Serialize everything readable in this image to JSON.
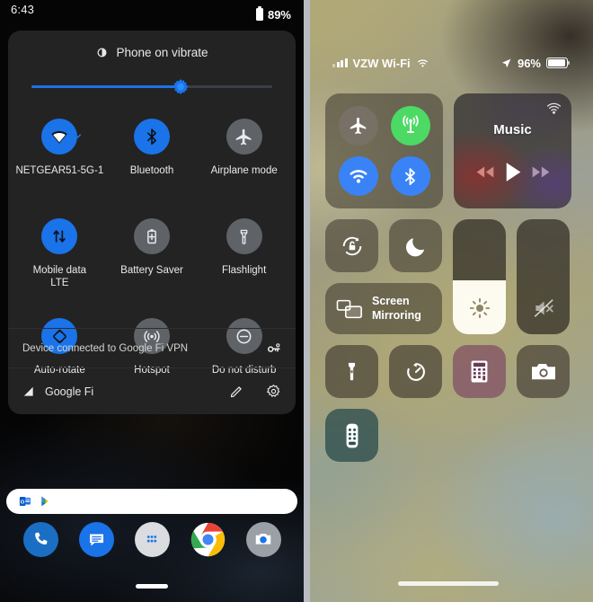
{
  "android": {
    "statusbar": {
      "time": "6:43",
      "battery_percent": "89%",
      "battery_icon": "battery-icon"
    },
    "ringer": {
      "label": "Phone on vibrate",
      "icon": "vibrate-icon"
    },
    "brightness_slider": {
      "name": "brightness-slider",
      "value_percent": 62,
      "accent": "#1a73e8"
    },
    "tiles": [
      {
        "label": "NETGEAR51-5G-1",
        "sub": "",
        "icon": "wifi-icon",
        "state": "on",
        "has_chevron": true
      },
      {
        "label": "Bluetooth",
        "sub": "",
        "icon": "bluetooth-icon",
        "state": "on",
        "has_chevron": false
      },
      {
        "label": "Airplane mode",
        "sub": "",
        "icon": "airplane-icon",
        "state": "off",
        "has_chevron": false
      },
      {
        "label": "Mobile data",
        "sub": "LTE",
        "icon": "mobile-data-icon",
        "state": "on",
        "has_chevron": false
      },
      {
        "label": "Battery Saver",
        "sub": "",
        "icon": "battery-saver-icon",
        "state": "off",
        "has_chevron": false
      },
      {
        "label": "Flashlight",
        "sub": "",
        "icon": "flashlight-icon",
        "state": "off",
        "has_chevron": false
      },
      {
        "label": "Auto-rotate",
        "sub": "",
        "icon": "auto-rotate-icon",
        "state": "on",
        "has_chevron": false
      },
      {
        "label": "Hotspot",
        "sub": "",
        "icon": "hotspot-icon",
        "state": "off",
        "has_chevron": false
      },
      {
        "label": "Do not disturb",
        "sub": "",
        "icon": "do-not-disturb-icon",
        "state": "off",
        "has_chevron": false
      }
    ],
    "vpn_row": {
      "text": "Device connected to Google Fi VPN",
      "icon": "vpn-key-icon"
    },
    "carrier_row": {
      "name": "Google Fi",
      "signal_icon": "signal-bars-icon",
      "edit_icon": "pencil-icon",
      "settings_icon": "gear-icon"
    },
    "notification_card": {
      "icons": [
        "outlook-icon",
        "google-play-icon"
      ]
    },
    "dock": [
      {
        "name": "phone-app",
        "icon": "phone-icon"
      },
      {
        "name": "messages-app",
        "icon": "messages-icon"
      },
      {
        "name": "app-drawer",
        "icon": "dots-grid-icon"
      },
      {
        "name": "chrome-app",
        "icon": "chrome-icon"
      },
      {
        "name": "camera-app",
        "icon": "camera-icon"
      }
    ],
    "home_indicator": "home-pill",
    "colors": {
      "panel_bg": "#232323",
      "accent": "#1a73e8",
      "tile_off": "#5f6368"
    }
  },
  "ios": {
    "statusbar": {
      "carrier": "VZW Wi-Fi",
      "signal_icon": "signal-bars-icon",
      "wifi_icon": "wifi-icon",
      "location_icon": "location-arrow-icon",
      "battery_percent": "96%",
      "battery_icon": "battery-icon",
      "battery_level": 96
    },
    "connectivity": [
      {
        "name": "airplane-mode-toggle",
        "icon": "airplane-icon",
        "state": "off",
        "color": "#7a7268"
      },
      {
        "name": "cellular-data-toggle",
        "icon": "cellular-icon",
        "state": "on",
        "color": "#4cd964"
      },
      {
        "name": "wifi-toggle",
        "icon": "wifi-icon",
        "state": "on",
        "color": "#3a83f7"
      },
      {
        "name": "bluetooth-toggle",
        "icon": "bluetooth-icon",
        "state": "on",
        "color": "#3a83f7"
      }
    ],
    "music": {
      "title": "Music",
      "airplay_icon": "airplay-icon",
      "prev_icon": "rewind-icon",
      "play_icon": "play-icon",
      "next_icon": "fast-forward-icon"
    },
    "row2": {
      "rotation_lock": {
        "name": "rotation-lock-toggle",
        "icon": "rotation-lock-icon",
        "state": "off"
      },
      "do_not_disturb": {
        "name": "do-not-disturb-toggle",
        "icon": "moon-icon",
        "state": "off"
      },
      "screen_mirroring": {
        "name": "screen-mirroring-button",
        "label_line1": "Screen",
        "label_line2": "Mirroring",
        "icon": "screen-mirroring-icon"
      },
      "brightness": {
        "name": "brightness-slider",
        "icon": "sun-icon",
        "value_percent": 47
      },
      "volume": {
        "name": "volume-slider",
        "icon": "mute-icon",
        "value_percent": 0,
        "muted": true
      }
    },
    "utilities": [
      {
        "name": "flashlight-button",
        "icon": "flashlight-icon"
      },
      {
        "name": "timer-button",
        "icon": "timer-icon"
      },
      {
        "name": "calculator-button",
        "icon": "calculator-icon"
      },
      {
        "name": "camera-button",
        "icon": "camera-icon"
      },
      {
        "name": "remote-button",
        "icon": "remote-icon"
      }
    ],
    "home_indicator": "home-bar"
  }
}
